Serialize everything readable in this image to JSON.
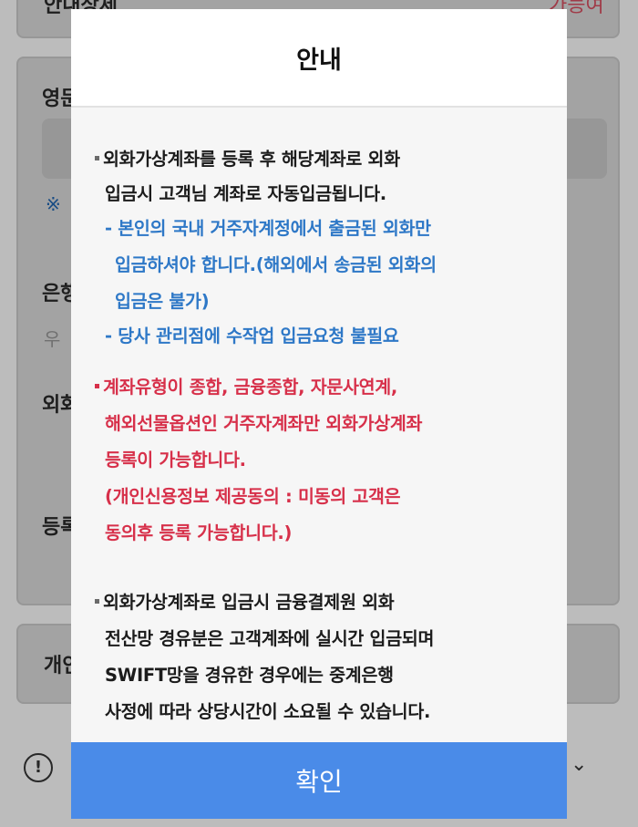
{
  "background": {
    "top_label": "안내상세",
    "top_right_label": "가능여",
    "section_label": "영문",
    "note_symbol": "※",
    "bank_label": "은행",
    "hint_text": "우",
    "foreign_label": "외화",
    "register_label": "등록",
    "bottom_label": "개인",
    "info_icon_glyph": "!",
    "chevron_glyph": "⌄"
  },
  "modal": {
    "title": "안내",
    "confirm_label": "확인",
    "lines": [
      "외화가상계좌를 등록 후 해당계좌로 외화",
      "입금시 고객님 계좌로 자동입금됩니다.",
      "- 본인의 국내 거주자계정에서 출금된 외화만",
      "입금하셔야 합니다.(해외에서 송금된 외화의",
      "입금은 불가)",
      "- 당사 관리점에 수작업 입금요청 불필요",
      "계좌유형이 종합, 금융종합, 자문사연계,",
      "해외선물옵션인 거주자계좌만 외화가상계좌",
      "등록이 가능합니다.",
      "(개인신용정보 제공동의 : 미동의 고객은",
      "동의후 등록 가능합니다.)",
      "외화가상계좌로 입금시 금융결제원 외화",
      "전산망 경유분은 고객계좌에 실시간 입금되며",
      "SWIFT망을 경유한 경우에는 중계은행",
      "사정에 따라 상당시간이 소요될 수 있습니다."
    ]
  },
  "colors": {
    "black_text": "#1c1c1c",
    "blue_text": "#2e78c7",
    "red_text": "#d7304a",
    "confirm_button": "#4a8be8"
  }
}
